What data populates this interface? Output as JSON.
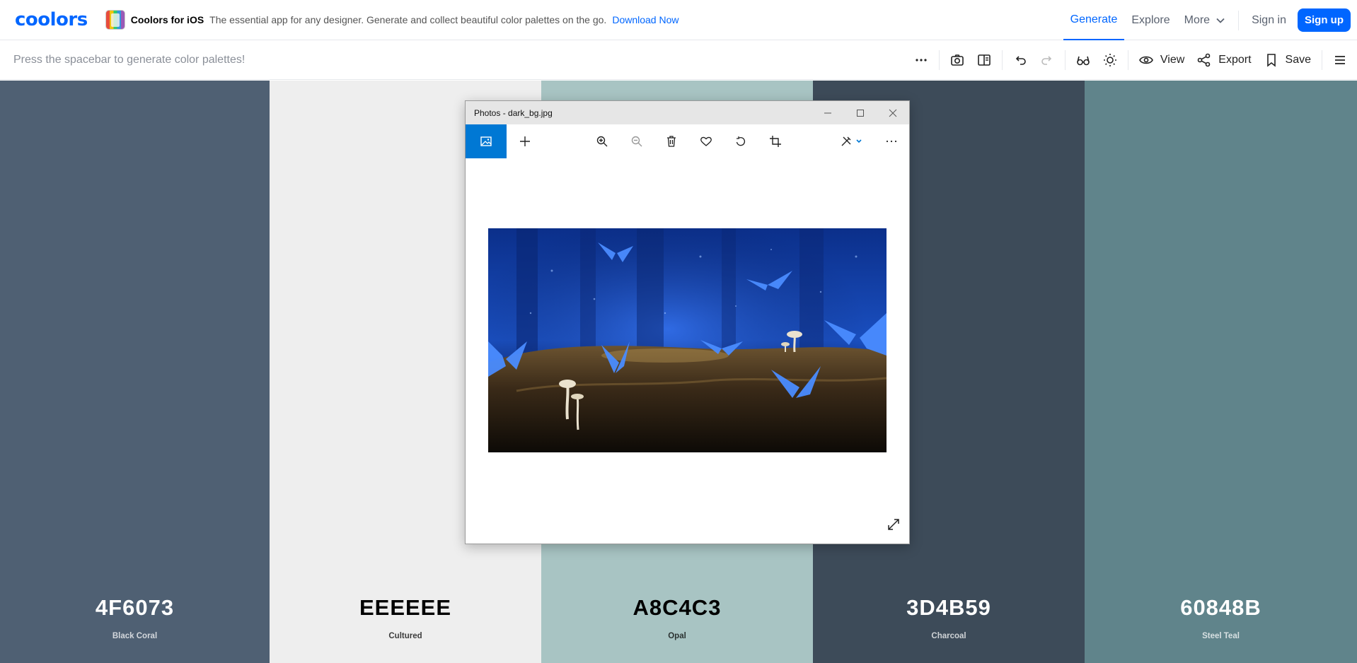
{
  "topbar": {
    "logo": "coolors",
    "promo_title": "Coolors for iOS",
    "promo_text": "The essential app for any designer. Generate and collect beautiful color palettes on the go.",
    "promo_link": "Download Now",
    "nav": {
      "generate": "Generate",
      "explore": "Explore",
      "more": "More",
      "signin": "Sign in",
      "signup": "Sign up"
    }
  },
  "toolbar": {
    "hint": "Press the spacebar to generate color palettes!",
    "view": "View",
    "export": "Export",
    "save": "Save"
  },
  "palette": [
    {
      "hex": "4F6073",
      "name": "Black Coral",
      "color": "#4F6073",
      "text_color": "#ffffff"
    },
    {
      "hex": "EEEEEE",
      "name": "Cultured",
      "color": "#EEEEEE",
      "text_color": "#000000"
    },
    {
      "hex": "A8C4C3",
      "name": "Opal",
      "color": "#A8C4C3",
      "text_color": "#000000"
    },
    {
      "hex": "3D4B59",
      "name": "Charcoal",
      "color": "#3D4B59",
      "text_color": "#ffffff"
    },
    {
      "hex": "60848B",
      "name": "Steel Teal",
      "color": "#60848B",
      "text_color": "#ffffff"
    }
  ],
  "photos_window": {
    "title": "Photos - dark_bg.jpg",
    "image_subject": "blue butterflies and mushrooms on mossy log"
  },
  "colors": {
    "accent": "#0066ff",
    "photos_accent": "#0078d4"
  }
}
